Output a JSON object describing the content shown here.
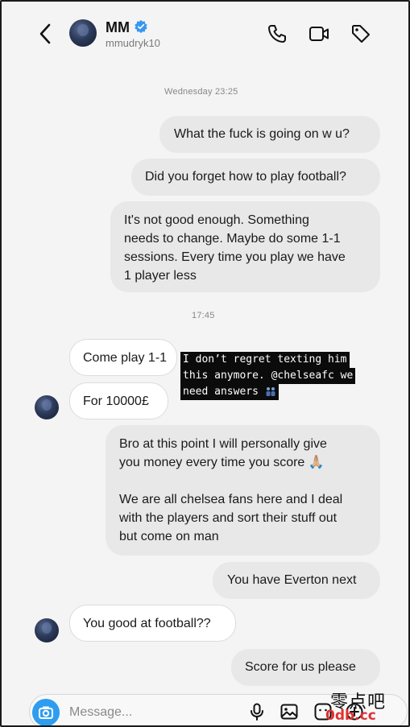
{
  "header": {
    "name": "MM",
    "username": "mmudryk10"
  },
  "timestamps": [
    "Wednesday 23:25",
    "17:45"
  ],
  "messages": [
    {
      "side": "out",
      "text": "What the fuck is going on w u?"
    },
    {
      "side": "out",
      "text": "Did you forget how to play football?"
    },
    {
      "side": "out",
      "text": "It's not good enough. Something\nneeds to change. Maybe do some 1-1\nsessions. Every time you play we have\n1 player less"
    },
    {
      "side": "in",
      "text": "Come play 1-1"
    },
    {
      "side": "in",
      "text": "For 10000£"
    },
    {
      "side": "out",
      "text": "Bro at this point I will personally give\nyou money every time you score 🙏🏼\n\nWe are all chelsea fans here and I deal\nwith the players and sort their stuff out\nbut come on man"
    },
    {
      "side": "out",
      "text": "You have Everton next"
    },
    {
      "side": "in",
      "text": "You good at football??"
    },
    {
      "side": "out",
      "text": "Score for us please"
    }
  ],
  "overlay": {
    "lines": [
      "I don’t regret texting him",
      "this anymore. @chelseafc we",
      "need answers"
    ]
  },
  "composer": {
    "placeholder": "Message..."
  },
  "watermark": {
    "site_cn": "零点吧",
    "site_url": "0db.cc"
  },
  "colors": {
    "outgoing_bubble": "#e8e8e8",
    "incoming_bubble": "#ffffff",
    "verified_badge": "#3897f0",
    "camera_button": "#2e9df0",
    "overlay_bg": "#0b0b0b"
  },
  "icons": [
    "back-chevron-icon",
    "verified-badge-icon",
    "phone-icon",
    "video-icon",
    "tag-icon",
    "camera-icon",
    "microphone-icon",
    "gallery-icon",
    "sticker-icon",
    "add-icon"
  ]
}
